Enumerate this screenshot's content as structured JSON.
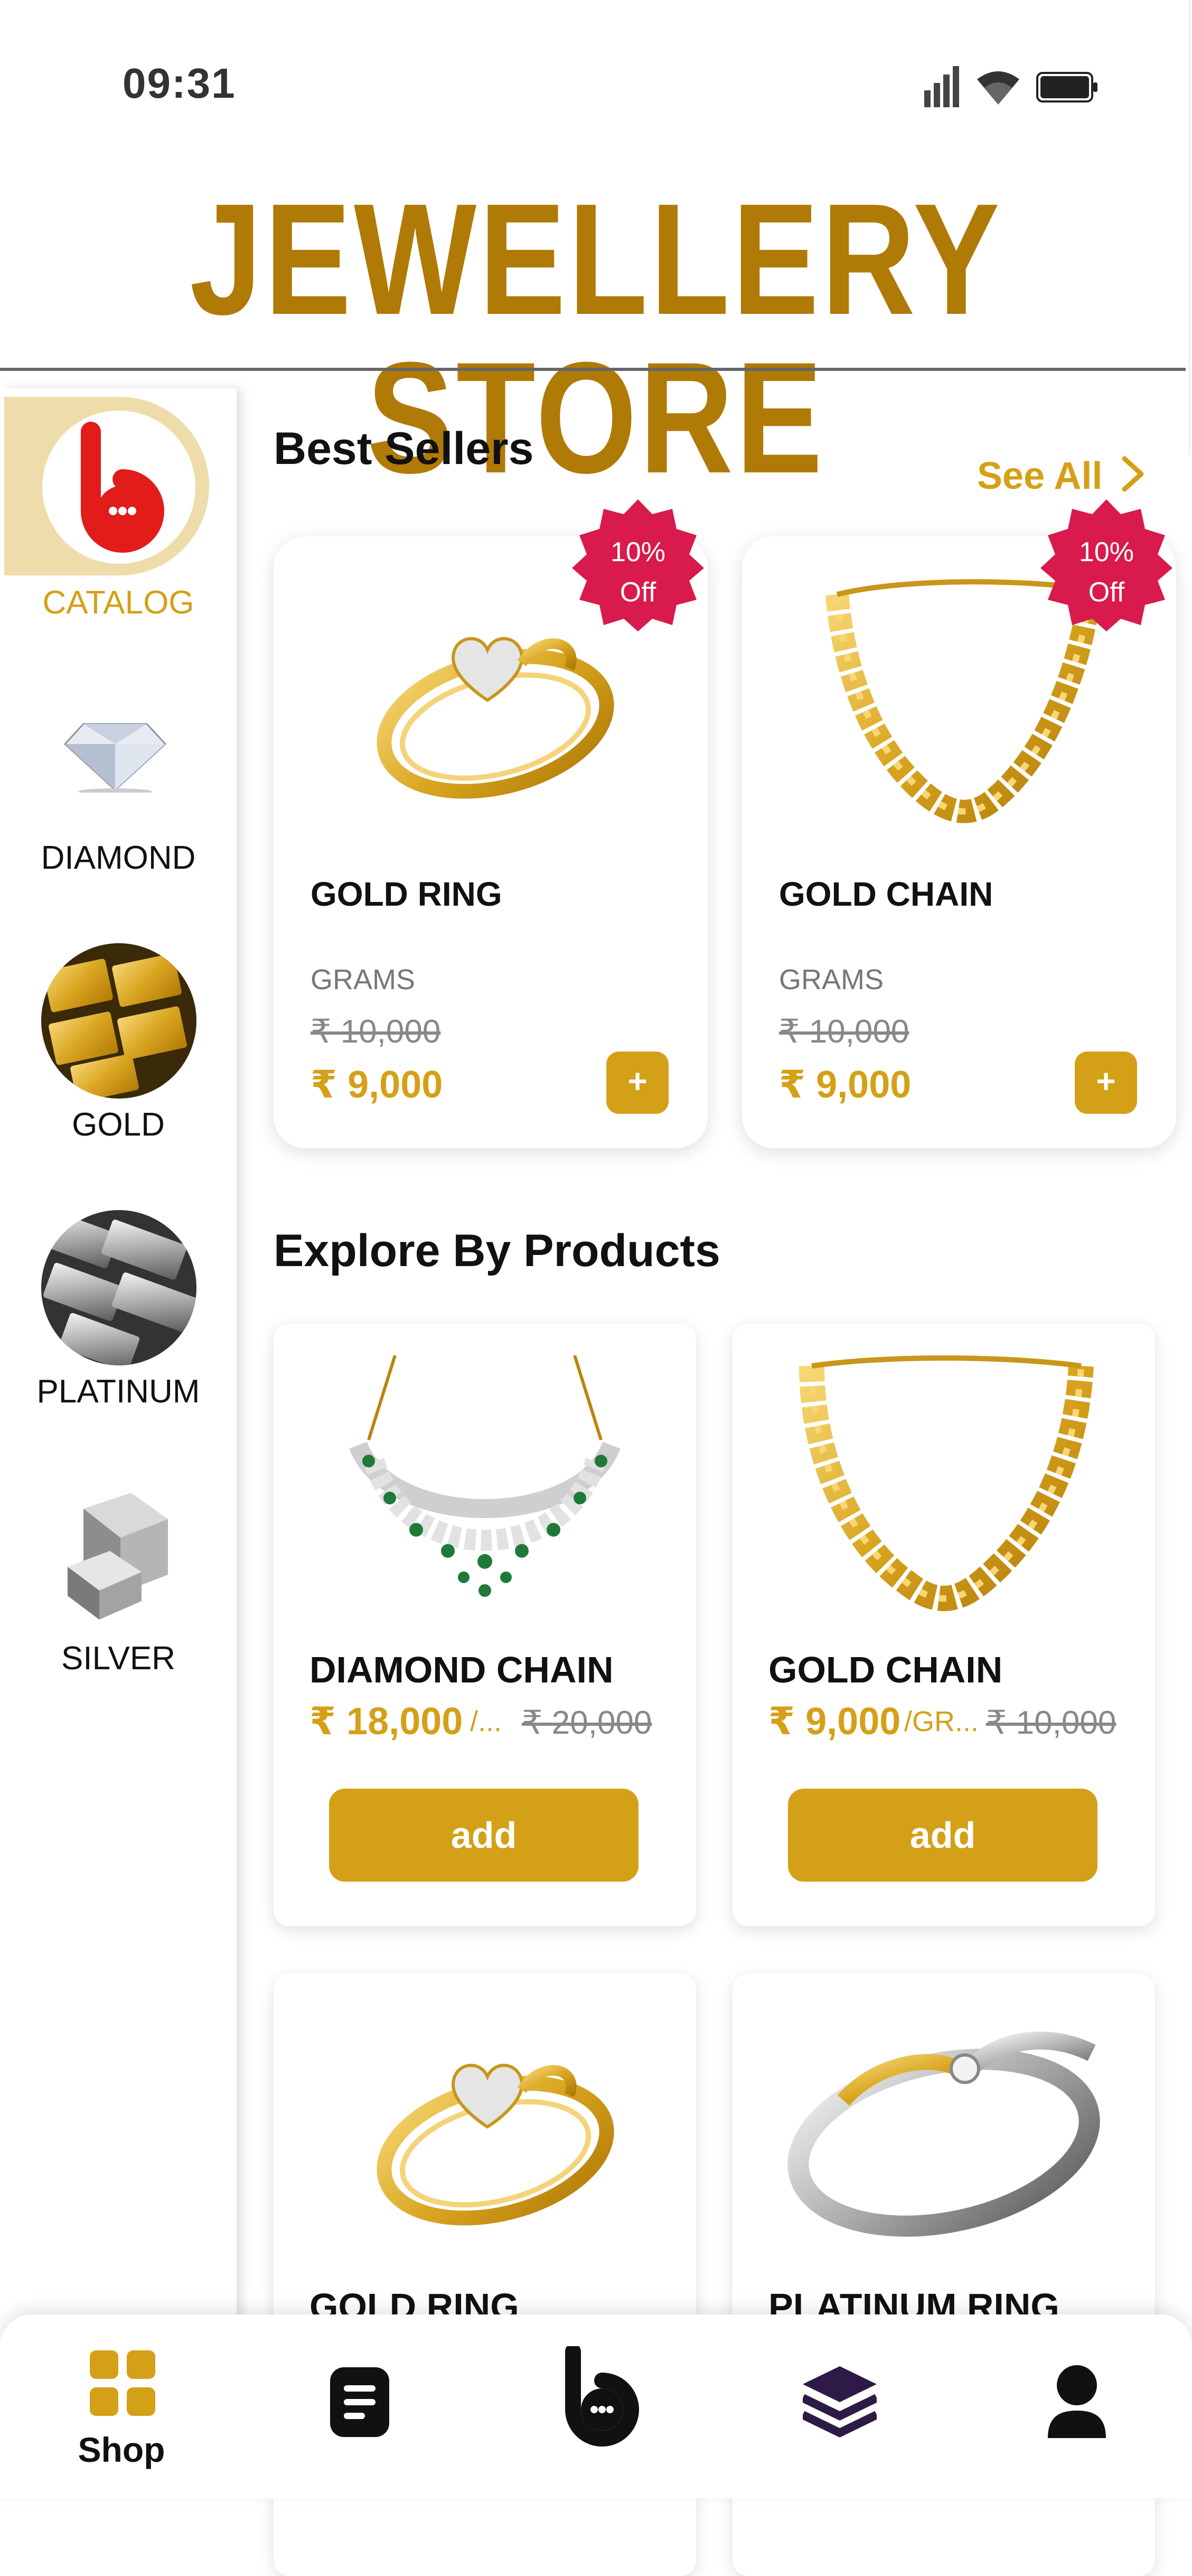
{
  "status_bar": {
    "time": "09:31",
    "icons": [
      "signal-icon",
      "wifi-icon",
      "battery-icon"
    ]
  },
  "app": {
    "title": "JEWELLERY STORE",
    "brand_color": "#B07A06",
    "accent_color": "#D4A017"
  },
  "sidebar": {
    "items": [
      {
        "label": "CATALOG",
        "icon": "logo-icon",
        "active": true
      },
      {
        "label": "DIAMOND",
        "icon": "diamond-icon"
      },
      {
        "label": "GOLD",
        "icon": "gold-bars-icon"
      },
      {
        "label": "PLATINUM",
        "icon": "platinum-bars-icon"
      },
      {
        "label": "SILVER",
        "icon": "silver-bars-icon"
      }
    ]
  },
  "best_sellers": {
    "heading": "Best Sellers",
    "see_all": "See All",
    "products": [
      {
        "badge_line1": "10%",
        "badge_line2": "Off",
        "name": "GOLD RING",
        "grams_label": "GRAMS",
        "old_price": "₹ 10,000",
        "price": "₹ 9,000",
        "add": "+"
      },
      {
        "badge_line1": "10%",
        "badge_line2": "Off",
        "name": "GOLD CHAIN",
        "grams_label": "GRAMS",
        "old_price": "₹ 10,000",
        "price": "₹ 9,000",
        "add": "+"
      }
    ]
  },
  "explore": {
    "heading": "Explore By Products",
    "products": [
      {
        "name": "DIAMOND  CHAIN",
        "price": "₹ 18,000",
        "unit": "/...",
        "old_price": "₹ 20,000",
        "add_label": "add"
      },
      {
        "name": "GOLD CHAIN",
        "price": "₹ 9,000",
        "unit": "/GR...",
        "old_price": "₹ 10,000",
        "add_label": "add"
      },
      {
        "name": "GOLD RING"
      },
      {
        "name": "PLATINUM RING"
      }
    ]
  },
  "bottom_nav": {
    "items": [
      {
        "label": "Shop",
        "icon": "grid-icon",
        "active": true
      },
      {
        "icon": "document-icon"
      },
      {
        "icon": "logo-icon"
      },
      {
        "icon": "layers-icon"
      },
      {
        "icon": "profile-icon"
      }
    ]
  }
}
